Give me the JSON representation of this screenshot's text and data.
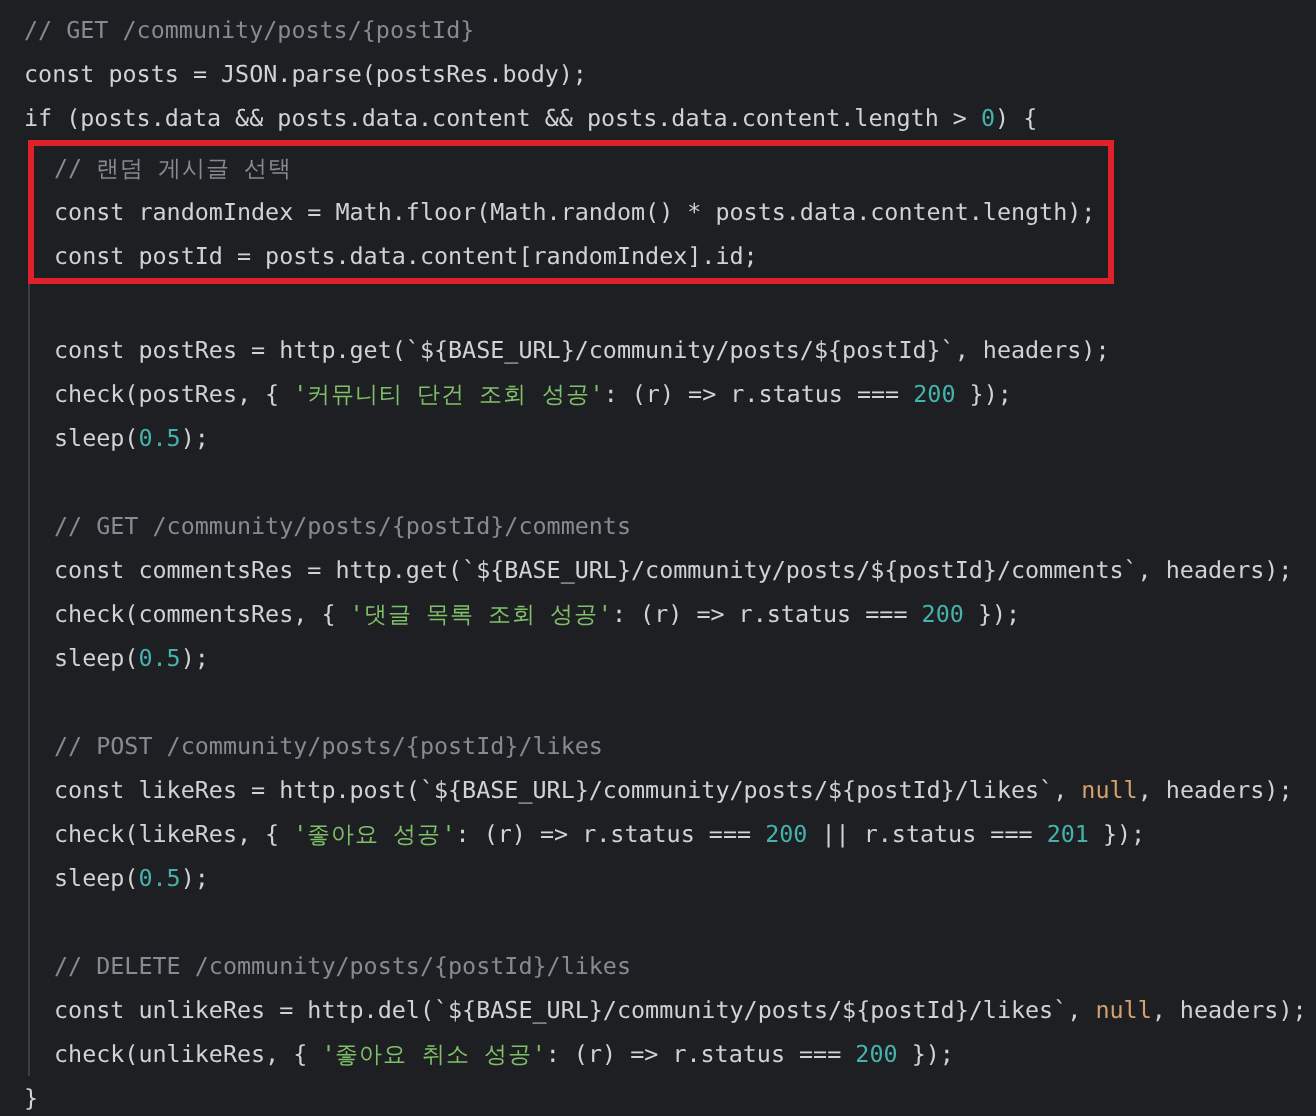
{
  "editor": {
    "lines": [
      {
        "kind": "line",
        "tokens": [
          {
            "kind": "comment",
            "text": "// GET /community/posts/{postId}"
          }
        ]
      },
      {
        "kind": "line",
        "tokens": [
          {
            "kind": "plain",
            "text": "const posts = JSON.parse(postsRes.body);"
          }
        ]
      },
      {
        "kind": "line",
        "tokens": [
          {
            "kind": "plain",
            "text": "if (posts.data && posts.data.content && posts.data.content.length > "
          },
          {
            "kind": "number",
            "text": "0"
          },
          {
            "kind": "plain",
            "text": ") {"
          }
        ],
        "children": [
          {
            "kind": "group",
            "highlighted": true,
            "lines": [
              {
                "kind": "line",
                "tokens": [
                  {
                    "kind": "comment",
                    "text": "// 랜덤 게시글 선택"
                  }
                ]
              },
              {
                "kind": "line",
                "tokens": [
                  {
                    "kind": "plain",
                    "text": "const randomIndex = Math.floor(Math.random() * posts.data.content.length);"
                  }
                ]
              },
              {
                "kind": "line",
                "tokens": [
                  {
                    "kind": "plain",
                    "text": "const postId = posts.data.content[randomIndex].id;"
                  }
                ]
              }
            ]
          },
          {
            "kind": "blank"
          },
          {
            "kind": "line",
            "tokens": [
              {
                "kind": "plain",
                "text": "const postRes = http.get(`${BASE_URL}/community/posts/${postId}`, headers);"
              }
            ]
          },
          {
            "kind": "line",
            "tokens": [
              {
                "kind": "plain",
                "text": "check(postRes, { "
              },
              {
                "kind": "string",
                "text": "'커뮤니티 단건 조회 성공'"
              },
              {
                "kind": "plain",
                "text": ": (r) => r.status === "
              },
              {
                "kind": "number",
                "text": "200"
              },
              {
                "kind": "plain",
                "text": " });"
              }
            ]
          },
          {
            "kind": "line",
            "tokens": [
              {
                "kind": "plain",
                "text": "sleep("
              },
              {
                "kind": "number",
                "text": "0.5"
              },
              {
                "kind": "plain",
                "text": ");"
              }
            ]
          },
          {
            "kind": "blank"
          },
          {
            "kind": "line",
            "tokens": [
              {
                "kind": "comment",
                "text": "// GET /community/posts/{postId}/comments"
              }
            ]
          },
          {
            "kind": "line",
            "tokens": [
              {
                "kind": "plain",
                "text": "const commentsRes = http.get(`${BASE_URL}/community/posts/${postId}/comments`, headers);"
              }
            ]
          },
          {
            "kind": "line",
            "tokens": [
              {
                "kind": "plain",
                "text": "check(commentsRes, { "
              },
              {
                "kind": "string",
                "text": "'댓글 목록 조회 성공'"
              },
              {
                "kind": "plain",
                "text": ": (r) => r.status === "
              },
              {
                "kind": "number",
                "text": "200"
              },
              {
                "kind": "plain",
                "text": " });"
              }
            ]
          },
          {
            "kind": "line",
            "tokens": [
              {
                "kind": "plain",
                "text": "sleep("
              },
              {
                "kind": "number",
                "text": "0.5"
              },
              {
                "kind": "plain",
                "text": ");"
              }
            ]
          },
          {
            "kind": "blank"
          },
          {
            "kind": "line",
            "tokens": [
              {
                "kind": "comment",
                "text": "// POST /community/posts/{postId}/likes"
              }
            ]
          },
          {
            "kind": "line",
            "tokens": [
              {
                "kind": "plain",
                "text": "const likeRes = http.post(`${BASE_URL}/community/posts/${postId}/likes`, "
              },
              {
                "kind": "literal",
                "text": "null"
              },
              {
                "kind": "plain",
                "text": ", headers);"
              }
            ]
          },
          {
            "kind": "line",
            "tokens": [
              {
                "kind": "plain",
                "text": "check(likeRes, { "
              },
              {
                "kind": "string",
                "text": "'좋아요 성공'"
              },
              {
                "kind": "plain",
                "text": ": (r) => r.status === "
              },
              {
                "kind": "number",
                "text": "200"
              },
              {
                "kind": "plain",
                "text": " || r.status === "
              },
              {
                "kind": "number",
                "text": "201"
              },
              {
                "kind": "plain",
                "text": " });"
              }
            ]
          },
          {
            "kind": "line",
            "tokens": [
              {
                "kind": "plain",
                "text": "sleep("
              },
              {
                "kind": "number",
                "text": "0.5"
              },
              {
                "kind": "plain",
                "text": ");"
              }
            ]
          },
          {
            "kind": "blank"
          },
          {
            "kind": "line",
            "tokens": [
              {
                "kind": "comment",
                "text": "// DELETE /community/posts/{postId}/likes"
              }
            ]
          },
          {
            "kind": "line",
            "tokens": [
              {
                "kind": "plain",
                "text": "const unlikeRes = http.del(`${BASE_URL}/community/posts/${postId}/likes`, "
              },
              {
                "kind": "literal",
                "text": "null"
              },
              {
                "kind": "plain",
                "text": ", headers);"
              }
            ]
          },
          {
            "kind": "line",
            "tokens": [
              {
                "kind": "plain",
                "text": "check(unlikeRes, { "
              },
              {
                "kind": "string",
                "text": "'좋아요 취소 성공'"
              },
              {
                "kind": "plain",
                "text": ": (r) => r.status === "
              },
              {
                "kind": "number",
                "text": "200"
              },
              {
                "kind": "plain",
                "text": " });"
              }
            ]
          }
        ]
      },
      {
        "kind": "line",
        "tokens": [
          {
            "kind": "plain",
            "text": "}"
          }
        ]
      }
    ]
  }
}
